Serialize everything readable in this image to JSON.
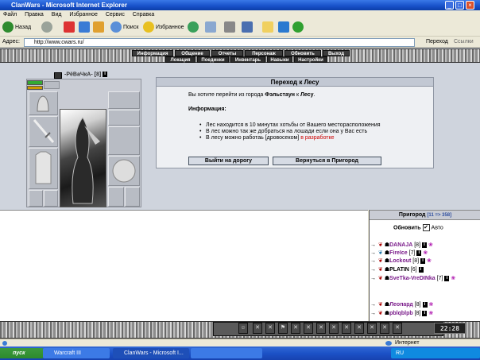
{
  "window": {
    "title": "ClanWars - Microsoft Internet Explorer",
    "min": "_",
    "max": "□",
    "close": "×"
  },
  "menu": [
    "Файл",
    "Правка",
    "Вид",
    "Избранное",
    "Сервис",
    "Справка"
  ],
  "toolbar": {
    "back": "Назад",
    "search": "Поиск",
    "favorites": "Избранное"
  },
  "address": {
    "label": "Адрес:",
    "url": "http://www.cwars.ru/",
    "go": "Переход",
    "links": "Ссылки"
  },
  "nav": {
    "top": [
      "Информация",
      "Общение",
      "Отчеты",
      "Персонаж",
      "Обновить",
      "Выход"
    ],
    "sub": [
      "Локация",
      "Поединки",
      "Инвентарь",
      "Навыки",
      "Настройки"
    ]
  },
  "character": {
    "name": "-РёВаЧкА-",
    "level": "[8]",
    "info": "i"
  },
  "dialog": {
    "title": "Переход к Лесу",
    "line_pre": "Вы хотите перейти из города ",
    "city": "Фэльстаун",
    "line_mid": " к ",
    "dest": "Лесу",
    "line_end": ".",
    "info_label": "Информация:",
    "bullet1": "Лес находится в 10 минутах хотьбы от Вашего месторасположения",
    "bullet2": "В лес можно так же добраться на лошади если она у Вас есть",
    "bullet3_pre": "В лесу можно работаь [дровосеком] ",
    "bullet3_link": "в разработке",
    "btn_go": "Выйти на дорогу",
    "btn_back": "Вернуться в Пригород"
  },
  "roster": {
    "title": "Пригород",
    "count": "[11 => 358]",
    "refresh": "Обновить",
    "auto_label": "Авто",
    "auto_checked": "✔",
    "players": [
      {
        "name": "DANAJA",
        "level": "[8]"
      },
      {
        "name": "FireIce",
        "level": "[7]"
      },
      {
        "name": "Lockout",
        "level": "[8]"
      },
      {
        "name": "PLATIN",
        "level": "[6]"
      },
      {
        "name": "SveTka-VreDINka",
        "level": "[7]"
      },
      {
        "name": "Леопард",
        "level": "[8]"
      },
      {
        "name": "pblqblpb",
        "level": "[8]"
      }
    ]
  },
  "clock": "22:28",
  "status": {
    "left": "",
    "zone": "Интернет"
  },
  "taskbar": {
    "start": "пуск",
    "task1": "Warcraft III",
    "task2": "ClanWars - Microsoft I...",
    "lang": "RU"
  }
}
